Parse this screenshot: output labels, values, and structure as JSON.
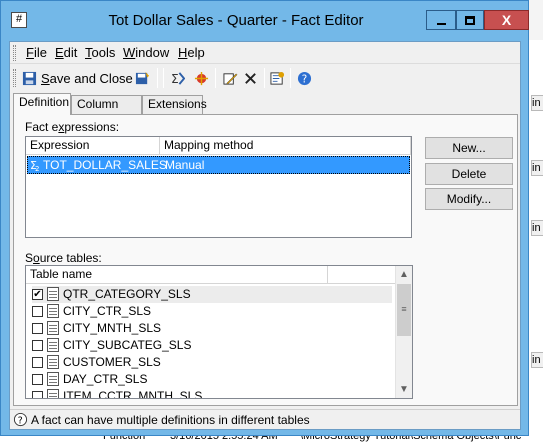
{
  "window": {
    "title": "Tot Dollar Sales - Quarter - Fact Editor",
    "system_icon_glyph": "#",
    "close_glyph": "X"
  },
  "menu": [
    {
      "label_u": "F",
      "label_rest": "ile"
    },
    {
      "label_u": "E",
      "label_rest": "dit"
    },
    {
      "label_u": "T",
      "label_rest": "ools"
    },
    {
      "label_u": "W",
      "label_rest": "indow"
    },
    {
      "label_u": "H",
      "label_rest": "elp"
    }
  ],
  "toolbar": {
    "save_close_u": "S",
    "save_close_rest": "ave and Close",
    "icons": [
      "save-icon",
      "properties-icon",
      "fact-wizard-icon",
      "edit-icon",
      "delete-icon",
      "find-icon",
      "help-icon"
    ]
  },
  "tabs": [
    "Definition",
    "Column Alias",
    "Extensions"
  ],
  "fact_expressions": {
    "label_u": "x",
    "label_pre": "Fact e",
    "label_post": "pressions:",
    "columns": [
      "Expression",
      "Mapping method"
    ],
    "rows": [
      {
        "expression": "TOT_DOLLAR_SALES",
        "mapping_method": "Manual"
      }
    ]
  },
  "buttons": {
    "new": "New...",
    "delete": "Delete",
    "modify": "Modify..."
  },
  "source_tables": {
    "label_pre": "S",
    "label_u": "o",
    "label_post": "urce tables:",
    "column": "Table name",
    "rows": [
      {
        "name": "QTR_CATEGORY_SLS",
        "checked": true
      },
      {
        "name": "CITY_CTR_SLS",
        "checked": false
      },
      {
        "name": "CITY_MNTH_SLS",
        "checked": false
      },
      {
        "name": "CITY_SUBCATEG_SLS",
        "checked": false
      },
      {
        "name": "CUSTOMER_SLS",
        "checked": false
      },
      {
        "name": "DAY_CTR_SLS",
        "checked": false
      },
      {
        "name": "ITEM_CCTR_MNTH_SLS",
        "checked": false
      }
    ],
    "check_glyph": "✔"
  },
  "status": {
    "text": "A fact can have multiple definitions in different tables"
  },
  "background": {
    "right_panes": [
      "in",
      "in",
      "in",
      "in"
    ],
    "bottom_items": [
      "Function",
      "3/16/2015 2:55:24 AM",
      "\\MicroStrategy Tutorial\\Schema Objects\\Func"
    ]
  }
}
